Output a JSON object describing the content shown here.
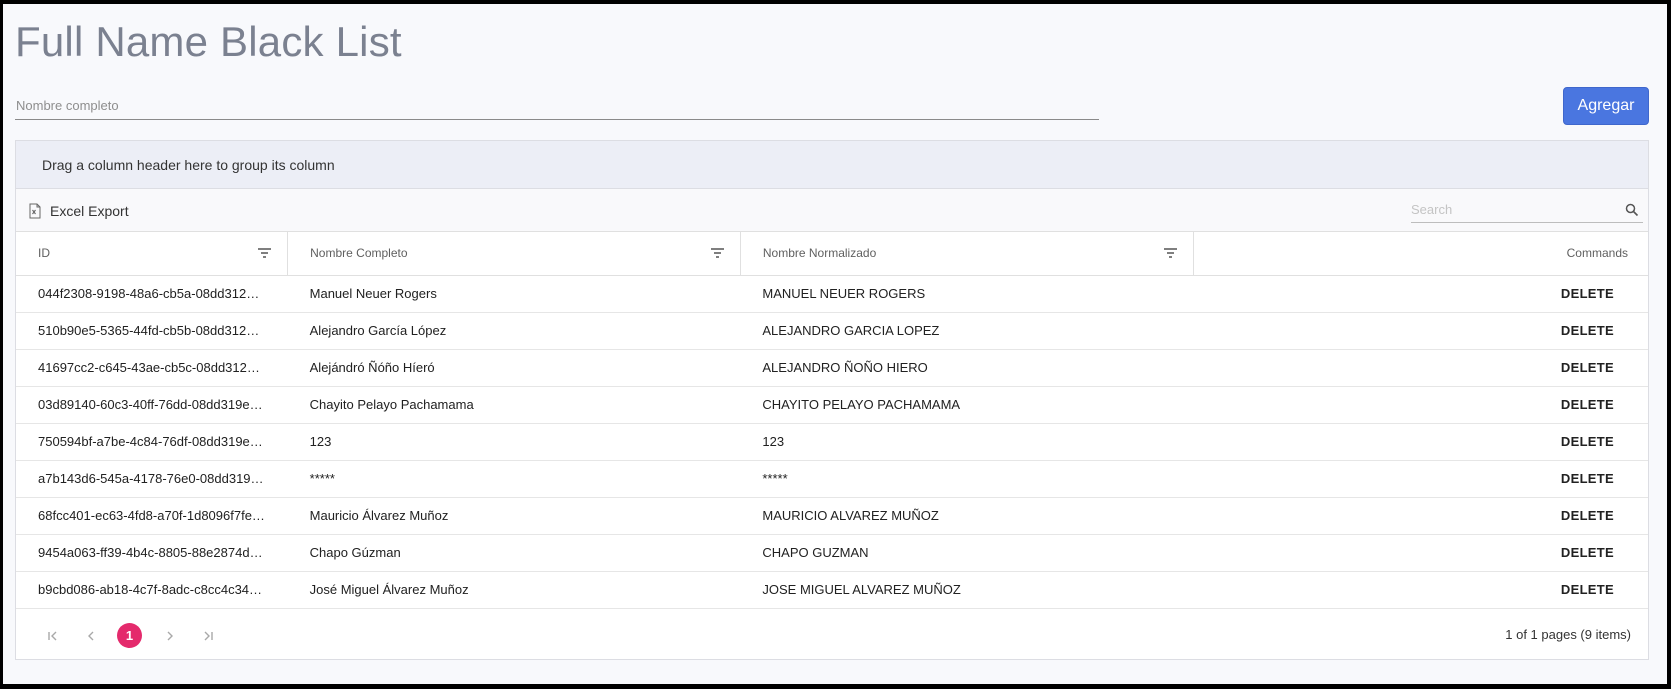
{
  "page": {
    "title": "Full Name Black List",
    "name_placeholder": "Nombre completo",
    "add_label": "Agregar"
  },
  "grid": {
    "group_panel_text": "Drag a column header here to group its column",
    "excel_export_label": "Excel Export",
    "search_placeholder": "Search",
    "columns": [
      "ID",
      "Nombre Completo",
      "Nombre Normalizado",
      "Commands"
    ],
    "rows": [
      {
        "id": "044f2308-9198-48a6-cb5a-08dd3127…",
        "nombre": "Manuel Neuer Rogers",
        "normalizado": "MANUEL NEUER ROGERS",
        "command": "DELETE"
      },
      {
        "id": "510b90e5-5365-44fd-cb5b-08dd3127…",
        "nombre": "Alejandro García López",
        "normalizado": "ALEJANDRO GARCIA LOPEZ",
        "command": "DELETE"
      },
      {
        "id": "41697cc2-c645-43ae-cb5c-08dd3127…",
        "nombre": "Alejándró Ñóño Híeró",
        "normalizado": "ALEJANDRO ÑOÑO HIERO",
        "command": "DELETE"
      },
      {
        "id": "03d89140-60c3-40ff-76dd-08dd319ed…",
        "nombre": "Chayito Pelayo Pachamama",
        "normalizado": "CHAYITO PELAYO PACHAMAMA",
        "command": "DELETE"
      },
      {
        "id": "750594bf-a7be-4c84-76df-08dd319ed…",
        "nombre": "123",
        "normalizado": "123",
        "command": "DELETE"
      },
      {
        "id": "a7b143d6-545a-4178-76e0-08dd319e…",
        "nombre": "*****",
        "normalizado": "*****",
        "command": "DELETE"
      },
      {
        "id": "68fcc401-ec63-4fd8-a70f-1d8096f7fe…",
        "nombre": "Mauricio Álvarez Muñoz",
        "normalizado": "MAURICIO ALVAREZ MUÑOZ",
        "command": "DELETE"
      },
      {
        "id": "9454a063-ff39-4b4c-8805-88e2874de…",
        "nombre": "Chapo Gúzman",
        "normalizado": "CHAPO GUZMAN",
        "command": "DELETE"
      },
      {
        "id": "b9cbd086-ab18-4c7f-8adc-c8cc4c34c…",
        "nombre": "José Miguel Álvarez Muñoz",
        "normalizado": "JOSE MIGUEL ALVAREZ MUÑOZ",
        "command": "DELETE"
      }
    ]
  },
  "pager": {
    "current_page": "1",
    "info": "1 of 1 pages (9 items)"
  },
  "colors": {
    "accent": "#4a76e0",
    "active_page": "#e42a6c",
    "title": "#7b8190"
  },
  "icons": [
    "excel-icon",
    "search-icon",
    "filter-icon",
    "first-page-icon",
    "prev-page-icon",
    "next-page-icon",
    "last-page-icon"
  ]
}
